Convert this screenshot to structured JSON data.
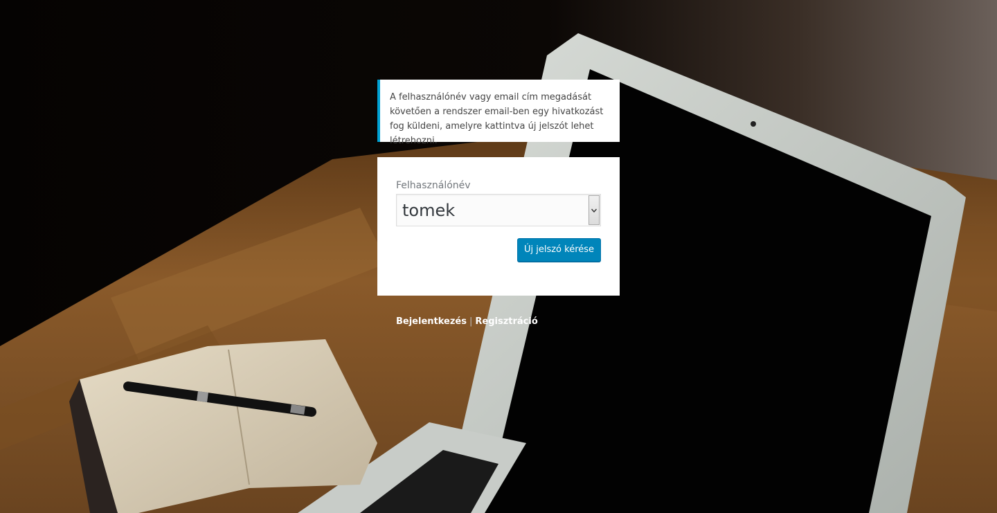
{
  "message": {
    "text": "A felhasználónév vagy email cím megadását követően a rendszer email-ben egy hivatkozást fog küldeni, amelyre kattintva új jelszót lehet létrehozni."
  },
  "form": {
    "username_label": "Felhasználónév",
    "username_value": "tomek",
    "submit_label": "Új jelszó kérése"
  },
  "nav": {
    "login": "Bejelentkezés",
    "separator": "|",
    "register": "Regisztráció"
  },
  "colors": {
    "accent": "#00a0d2",
    "button": "#0085ba"
  }
}
